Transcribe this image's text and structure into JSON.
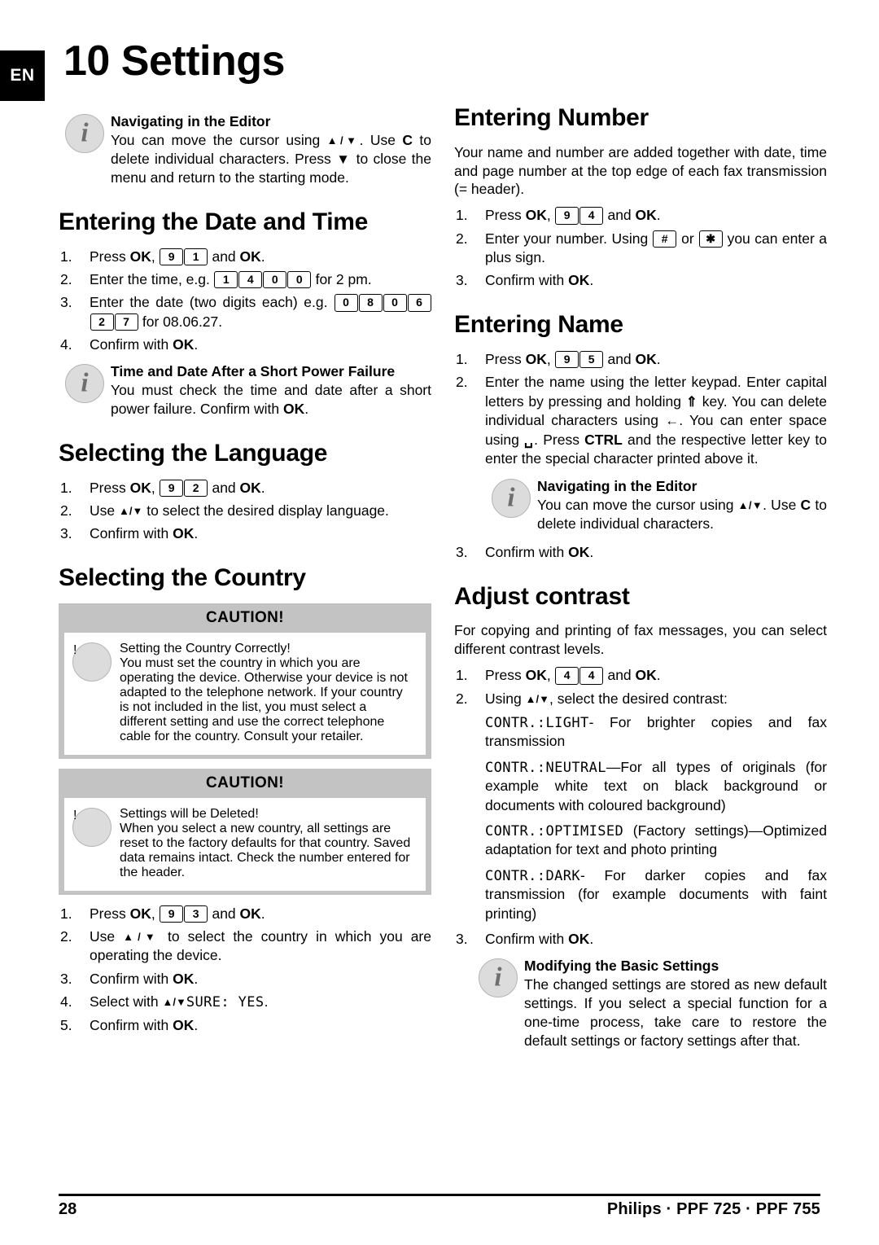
{
  "page": {
    "language_badge": "EN",
    "chapter_title": "10 Settings",
    "page_number": "28",
    "product_footer": "Philips · PPF 725 · PPF 755"
  },
  "notes": {
    "navigating_editor_1": {
      "title": "Navigating in the Editor",
      "body_pre": "You can move the cursor using ",
      "arrows": "▲/▼",
      "body_mid": ". Use ",
      "key_c": "C",
      "body_mid2": " to delete individual characters. Press ",
      "stop_glyph": "▼",
      "body_post": " to close the menu and return to the starting mode."
    },
    "power_failure": {
      "title": "Time and Date After a Short Power Failure",
      "body_pre": "You must check the time and date after a short power failure. Confirm with ",
      "ok": "OK",
      "body_post": "."
    },
    "navigating_editor_2": {
      "title": "Navigating in the Editor",
      "body_pre": "You can move the cursor using ",
      "arrows": "▲/▼",
      "body_mid": ". Use ",
      "key_c": "C",
      "body_post": " to delete individual characters."
    },
    "modifying_basic": {
      "title": "Modifying the Basic Settings",
      "body": "The changed settings are stored as new default settings. If you select a special function for a one-time process, take care to restore the default settings or factory settings after that."
    }
  },
  "cautions": {
    "country": {
      "header": "CAUTION!",
      "title": "Setting the Country Correctly!",
      "body": "You must set the country in which you are operating the device. Otherwise your device is not adapted to the telephone network. If your country is not included in the list, you must select a different setting and use the correct telephone cable for the country. Consult your retailer."
    },
    "settings_deleted": {
      "header": "CAUTION!",
      "title": "Settings will be Deleted!",
      "body": "When you select a new country, all settings are reset to the factory defaults for that country. Saved data remains intact. Check the number entered for the header."
    }
  },
  "sections": {
    "date_time": {
      "heading": "Entering the Date and Time",
      "step1": {
        "num": "1.",
        "pre": "Press ",
        "ok1": "OK",
        "comma": ", ",
        "keys": [
          "9",
          "1"
        ],
        "mid": " and ",
        "ok2": "OK",
        "post": "."
      },
      "step2": {
        "num": "2.",
        "pre": "Enter the time, e.g. ",
        "keys": [
          "1",
          "4",
          "0",
          "0"
        ],
        "post": " for 2 pm."
      },
      "step3": {
        "num": "3.",
        "pre": "Enter the date (two digits each) e.g. ",
        "keys": [
          "0",
          "8",
          "0",
          "6",
          "2",
          "7"
        ],
        "post": " for 08.06.27."
      },
      "step4": {
        "num": "4.",
        "pre": "Confirm with ",
        "ok": "OK",
        "post": "."
      }
    },
    "language": {
      "heading": "Selecting the Language",
      "step1": {
        "num": "1.",
        "pre": "Press ",
        "ok1": "OK",
        "comma": ", ",
        "keys": [
          "9",
          "2"
        ],
        "mid": " and ",
        "ok2": "OK",
        "post": "."
      },
      "step2": {
        "num": "2.",
        "pre": "Use ",
        "arrows": "▲/▼",
        "post": " to select the desired display language."
      },
      "step3": {
        "num": "3.",
        "pre": "Confirm with ",
        "ok": "OK",
        "post": "."
      }
    },
    "country": {
      "heading": "Selecting the Country",
      "step1": {
        "num": "1.",
        "pre": "Press ",
        "ok1": "OK",
        "comma": ", ",
        "keys": [
          "9",
          "3"
        ],
        "mid": " and ",
        "ok2": "OK",
        "post": "."
      },
      "step2": {
        "num": "2.",
        "pre": "Use ",
        "arrows": "▲/▼",
        "post": " to select the country in which you are operating the device."
      },
      "step3": {
        "num": "3.",
        "pre": "Confirm with ",
        "ok": "OK",
        "post": "."
      },
      "step4": {
        "num": "4.",
        "pre": "Select with ",
        "arrows": "▲/▼",
        "lcd": "SURE: YES",
        "post": "."
      },
      "step5": {
        "num": "5.",
        "pre": "Confirm with ",
        "ok": "OK",
        "post": "."
      }
    },
    "number": {
      "heading": "Entering Number",
      "intro": "Your name and number are added together with date, time and page number at the top edge of each fax transmission (= header).",
      "step1": {
        "num": "1.",
        "pre": "Press ",
        "ok1": "OK",
        "comma": ", ",
        "keys": [
          "9",
          "4"
        ],
        "mid": " and ",
        "ok2": "OK",
        "post": "."
      },
      "step2": {
        "num": "2.",
        "pre": "Enter your number. Using ",
        "key_hash": "#",
        "mid": " or ",
        "key_star": "✱",
        "post": " you can enter a plus sign."
      },
      "step3": {
        "num": "3.",
        "pre": "Confirm with ",
        "ok": "OK",
        "post": "."
      }
    },
    "name": {
      "heading": "Entering Name",
      "step1": {
        "num": "1.",
        "pre": "Press ",
        "ok1": "OK",
        "comma": ", ",
        "keys": [
          "9",
          "5"
        ],
        "mid": " and ",
        "ok2": "OK",
        "post": "."
      },
      "step2": {
        "num": "2.",
        "p1": "Enter the name using the letter keypad. Enter capital letters by pressing and holding ",
        "shift_glyph": "⇑",
        "p2": " key. You can delete individual characters using ",
        "back_glyph": "←",
        "p3": ". You can enter space using ",
        "space_glyph": "␣",
        "p4": ". Press ",
        "ctrl": "CTRL",
        "p5": " and the respective letter key to enter the special character printed above it."
      },
      "step3": {
        "num": "3.",
        "pre": "Confirm with ",
        "ok": "OK",
        "post": "."
      }
    },
    "contrast": {
      "heading": "Adjust contrast",
      "intro": "For copying and printing of fax messages, you can select different contrast levels.",
      "step1": {
        "num": "1.",
        "pre": "Press ",
        "ok1": "OK",
        "comma": ", ",
        "keys": [
          "4",
          "4"
        ],
        "mid": " and ",
        "ok2": "OK",
        "post": "."
      },
      "step2": {
        "num": "2.",
        "pre": "Using ",
        "arrows": "▲/▼",
        "post": ", select the desired contrast:"
      },
      "options": [
        {
          "lcd": "CONTR.:LIGHT",
          "desc": "- For brighter copies and fax transmission"
        },
        {
          "lcd": "CONTR.:NEUTRAL",
          "desc": "—For all types of originals (for example white text on black background or documents with coloured background)"
        },
        {
          "lcd": "CONTR.:OPTIMISED",
          "desc": " (Factory settings)—Optimized adaptation for text and photo printing"
        },
        {
          "lcd": "CONTR.:DARK",
          "desc": "- For darker copies and fax transmission (for example documents with faint printing)"
        }
      ],
      "step3": {
        "num": "3.",
        "pre": "Confirm with ",
        "ok": "OK",
        "post": "."
      }
    }
  },
  "icons": {
    "info": "i",
    "warning": "!"
  }
}
